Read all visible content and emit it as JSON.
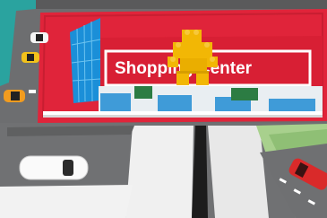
{
  "photo": {
    "subject": "lego-figure-on-play-mat",
    "sign_text": "Shopping Center",
    "colors": {
      "road": "#6f7071",
      "mat_red": "#e2253a",
      "teal": "#2fa9a4",
      "blue_glass": "#1c8fd6",
      "lego_yellow": "#f2b705",
      "sign_white": "#ffffff"
    }
  }
}
